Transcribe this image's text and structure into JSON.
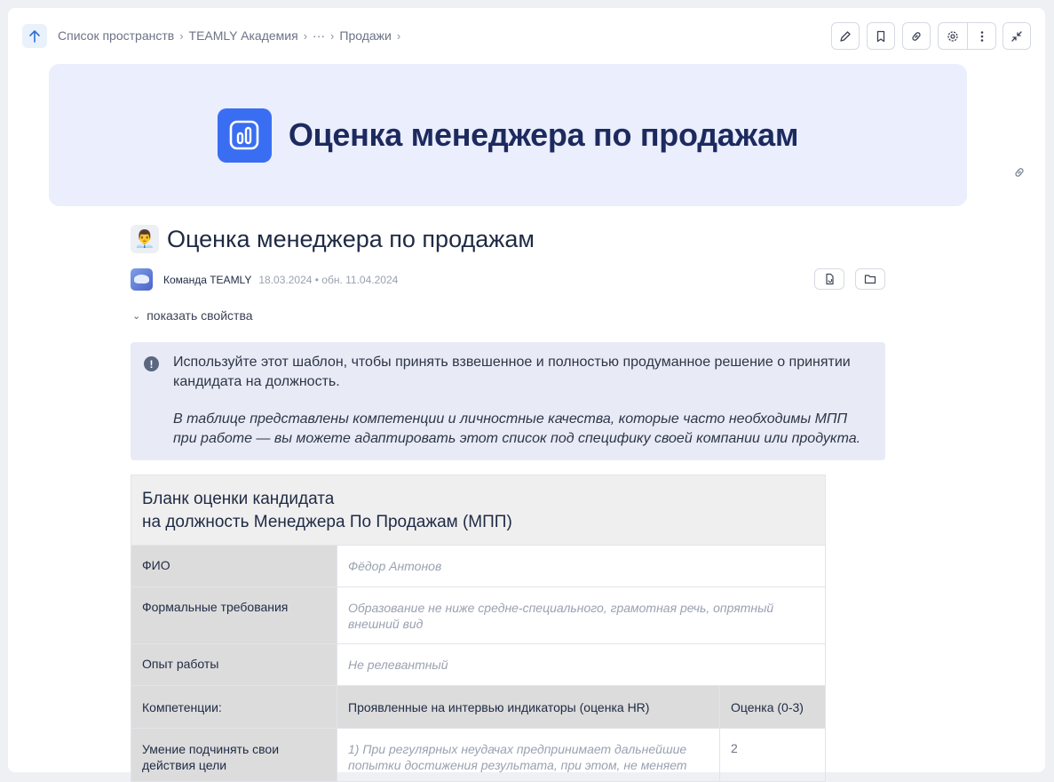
{
  "breadcrumb": {
    "items": [
      "Список пространств",
      "TEAMLY Академия",
      "···",
      "Продажи"
    ]
  },
  "toolbar": {
    "icons": [
      "pencil-icon",
      "bookmark-icon",
      "link-icon",
      "gear-icon",
      "more-vertical-icon",
      "collapse-icon"
    ]
  },
  "banner": {
    "title": "Оценка менеджера по продажам",
    "accent": "#3a6ef2"
  },
  "doc": {
    "emoji": "👨‍💼",
    "title": "Оценка менеджера по продажам",
    "author": "Команда TEAMLY",
    "dates": "18.03.2024 • обн. 11.04.2024",
    "show_props": "показать свойства"
  },
  "callout": {
    "text": "Используйте этот шаблон, чтобы принять взвешенное и полностью продуманное решение о принятии кандидата на должность.",
    "italic": "В таблице представлены компетенции и личностные качества, которые часто необходимы МПП при работе — вы можете адаптировать этот список под специфику своей компании или продукта."
  },
  "table": {
    "title_line1": "Бланк оценки кандидата",
    "title_line2": "на должность Менеджера По Продажам (МПП)",
    "rows": [
      {
        "label": "ФИО",
        "value": "Фёдор Антонов"
      },
      {
        "label": "Формальные требования",
        "value": "Образование не ниже средне-специального, грамотная речь, опрятный внешний вид"
      },
      {
        "label": "Опыт работы",
        "value": "Не релевантный"
      }
    ],
    "header": {
      "col1": "Компетенции:",
      "col2": "Проявленные на интервью индикаторы (оценка HR)",
      "col3": "Оценка (0-3)"
    },
    "competency": {
      "label": "Умение подчинять свои действия цели",
      "value": "1) При регулярных неудачах предпринимает дальнейшие попытки достижения результата, при этом, не меняет",
      "score": "2"
    }
  }
}
